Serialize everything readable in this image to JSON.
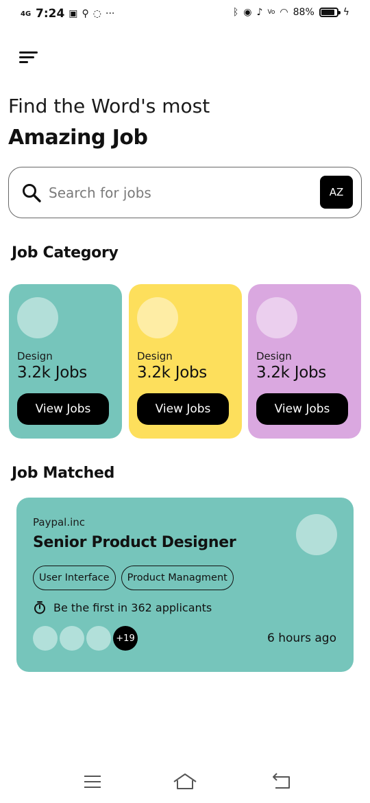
{
  "status_bar": {
    "network": "4G",
    "time": "7:24",
    "battery_percent": "88%",
    "battery_level": 0.88
  },
  "header": {
    "line1": "Find the Word's most",
    "line2": "Amazing Job"
  },
  "search": {
    "placeholder": "Search for jobs",
    "value": "",
    "sort_label": "AZ"
  },
  "categories": {
    "title": "Job Category",
    "items": [
      {
        "label": "Design",
        "count": "3.2k Jobs",
        "button": "View Jobs",
        "color": "#76c5bb"
      },
      {
        "label": "Design",
        "count": "3.2k Jobs",
        "button": "View Jobs",
        "color": "#fddf5c"
      },
      {
        "label": "Design",
        "count": "3.2k Jobs",
        "button": "View Jobs",
        "color": "#daa8e0"
      }
    ]
  },
  "matched": {
    "title": "Job Matched",
    "job": {
      "company": "Paypal.inc",
      "title": "Senior Product Designer",
      "tags": [
        "User Interface",
        "Product Managment"
      ],
      "applicants": "Be the first in 362 applicants",
      "more_count": "+19",
      "posted": "6 hours ago",
      "color": "#76c5bb"
    }
  },
  "colors": {
    "accent_dark": "#000000",
    "background": "#ffffff"
  }
}
